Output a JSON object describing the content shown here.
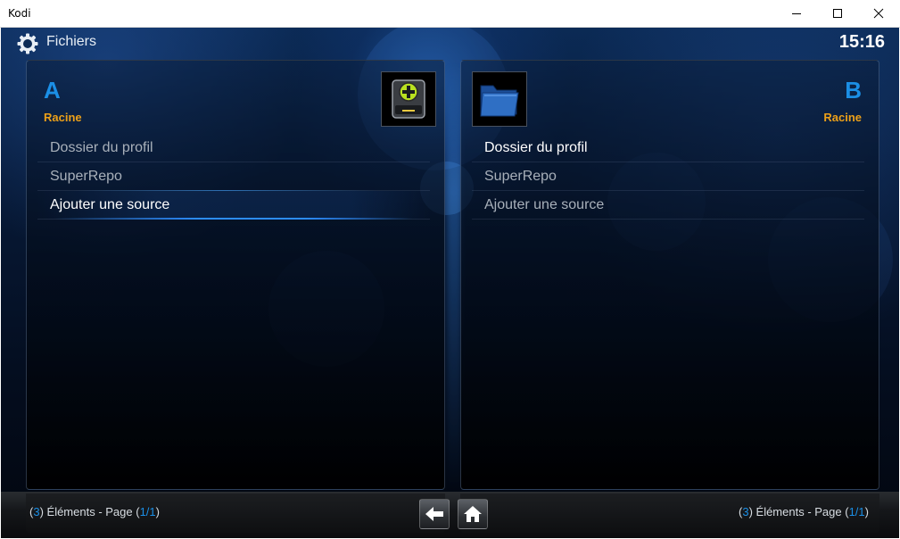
{
  "window": {
    "title": "Kodi"
  },
  "header": {
    "title": "Fichiers",
    "clock": "15:16"
  },
  "left_panel": {
    "letter": "A",
    "subtitle": "Racine",
    "items": [
      {
        "label": "Dossier du profil"
      },
      {
        "label": "SuperRepo"
      },
      {
        "label": "Ajouter une source"
      }
    ],
    "footer": {
      "open": "(",
      "count": "3",
      "mid": ") Éléments - Page (",
      "page": "1/1",
      "close": ")"
    }
  },
  "right_panel": {
    "letter": "B",
    "subtitle": "Racine",
    "items": [
      {
        "label": "Dossier du profil"
      },
      {
        "label": "SuperRepo"
      },
      {
        "label": "Ajouter une source"
      }
    ],
    "footer": {
      "open": "(",
      "count": "3",
      "mid": ") Éléments - Page (",
      "page": "1/1",
      "close": ")"
    }
  },
  "icons": {
    "settings": "gear-icon",
    "add_source": "add-drive-icon",
    "folder": "folder-icon",
    "back": "back-arrow-icon",
    "home": "home-icon"
  },
  "colors": {
    "accent_blue": "#1b8fe6",
    "subtitle_orange": "#eca019"
  }
}
